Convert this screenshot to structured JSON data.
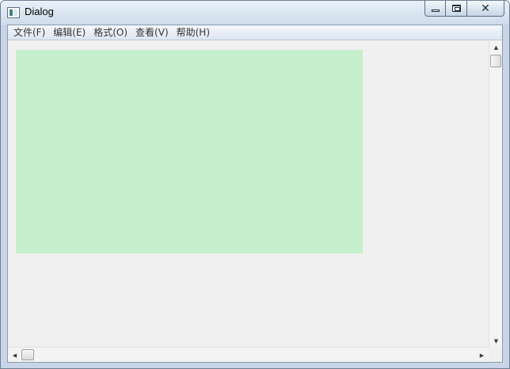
{
  "window": {
    "title": "Dialog"
  },
  "icons": {
    "app": "app-window-icon",
    "minimize": "minimize-icon",
    "maximize": "maximize-icon",
    "close": "close-icon",
    "scroll_up": "arrow-up-icon",
    "scroll_down": "arrow-down-icon",
    "scroll_left": "arrow-left-icon",
    "scroll_right": "arrow-right-icon"
  },
  "glyphs": {
    "close": "✕",
    "up": "▲",
    "down": "▼",
    "left": "◀",
    "right": "▶"
  },
  "menu": {
    "items": [
      {
        "label": "文件(F)"
      },
      {
        "label": "编辑(E)"
      },
      {
        "label": "格式(O)"
      },
      {
        "label": "查看(V)"
      },
      {
        "label": "帮助(H)"
      }
    ]
  },
  "colors": {
    "content_rect": "#c6efce",
    "client_bg": "#f0f0f0"
  }
}
